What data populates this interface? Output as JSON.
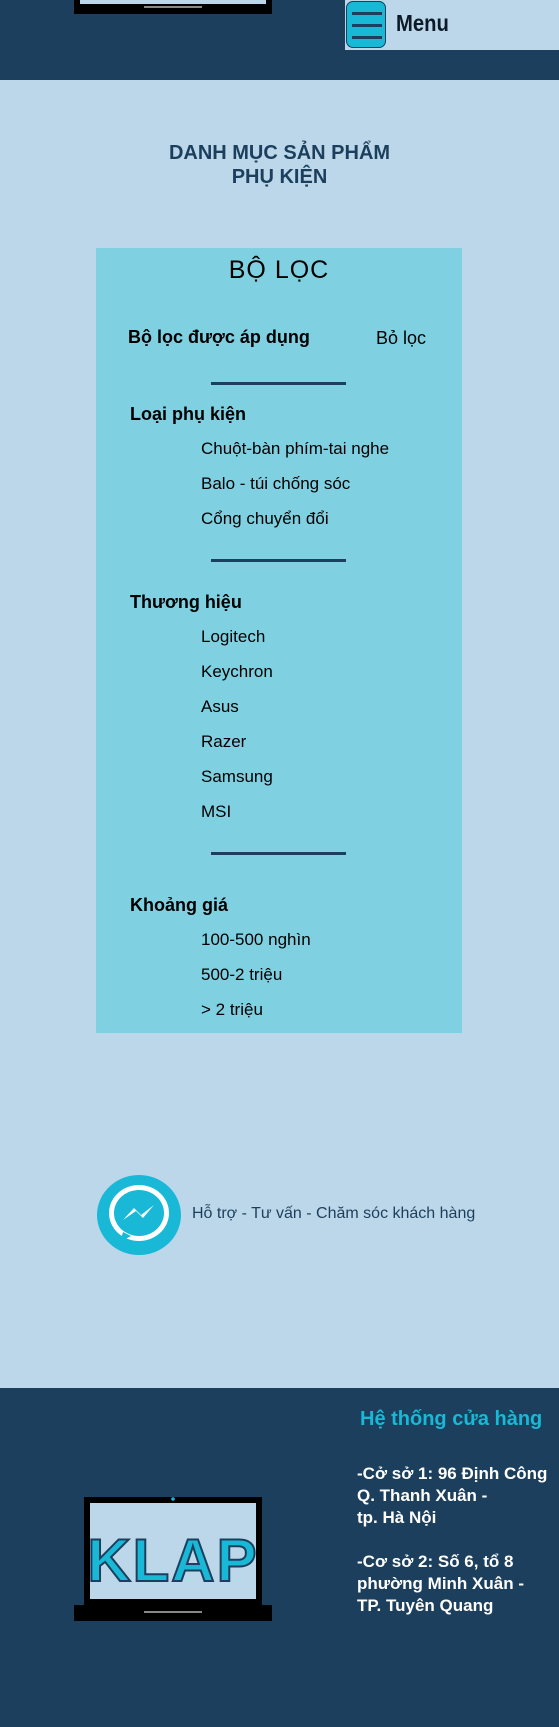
{
  "header": {
    "menu_label": "Menu"
  },
  "category": {
    "line1": "DANH MỤC SẢN PHẨM",
    "line2": "PHỤ KIỆN"
  },
  "filter": {
    "title": "BỘ LỌC",
    "applied_label": "Bộ lọc được áp dụng",
    "clear_label": "Bỏ lọc",
    "sections": [
      {
        "title": "Loại phụ kiện",
        "options": [
          "Chuột-bàn phím-tai nghe",
          "Balo - túi chống sóc",
          "Cổng chuyển đổi"
        ]
      },
      {
        "title": "Thương hiệu",
        "options": [
          "Logitech",
          "Keychron",
          "Asus",
          "Razer",
          "Samsung",
          "MSI"
        ]
      },
      {
        "title": "Khoảng giá",
        "options": [
          "100-500 nghìn",
          "500-2 triệu",
          "> 2 triệu"
        ]
      }
    ]
  },
  "support": {
    "text": "Hỗ trợ - Tư vấn - Chăm sóc khách hàng",
    "icon": "messenger-icon"
  },
  "footer": {
    "stores_title": "Hệ thống cửa hàng",
    "store1": [
      "-Cở sở 1: 96 Định Công",
      "Q. Thanh Xuân -",
      "tp. Hà Nội"
    ],
    "store2": [
      "-Cơ sở 2: Số 6, tổ 8",
      "phường Minh Xuân -",
      "TP. Tuyên Quang"
    ],
    "logo_text": "KLAP"
  },
  "colors": {
    "navy": "#1b3f5c",
    "light_blue": "#bdd7ea",
    "panel": "#7fd1e2",
    "accent": "#18b8d6"
  }
}
